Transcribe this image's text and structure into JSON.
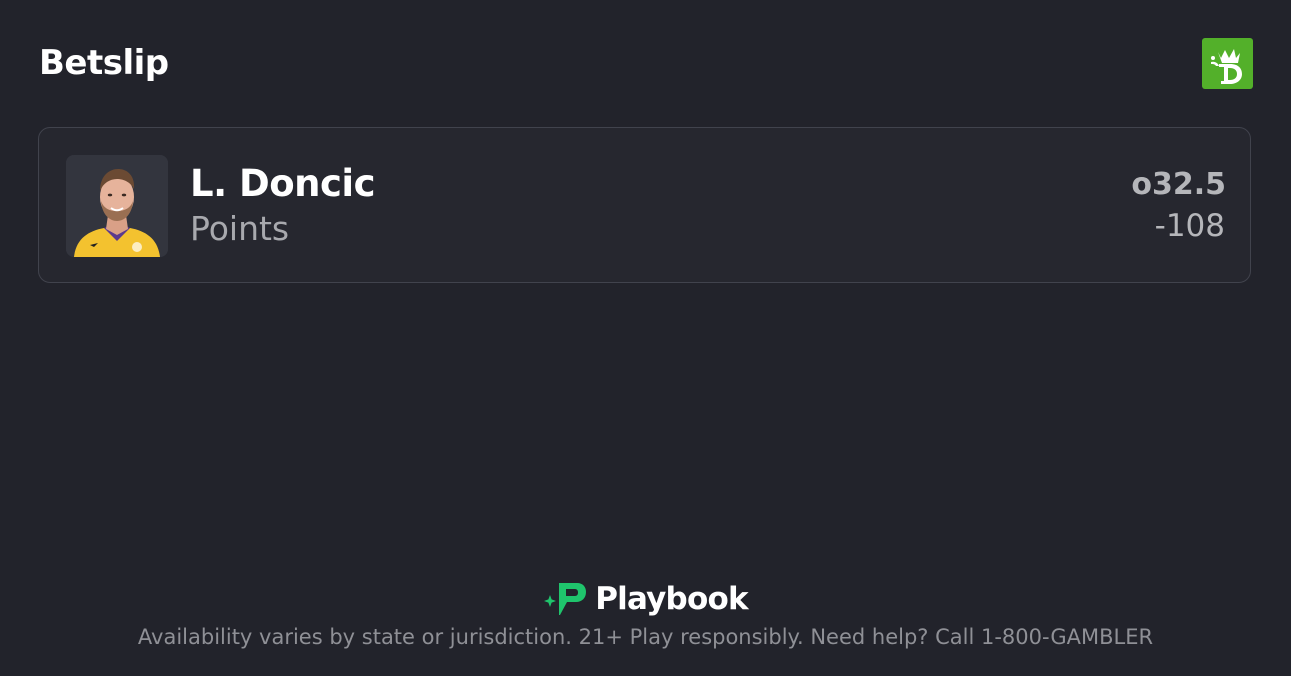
{
  "header": {
    "title": "Betslip",
    "brand_logo": "draftkings-crown-icon",
    "brand_color": "#53b02a"
  },
  "bet": {
    "player_name": "L. Doncic",
    "market": "Points",
    "line": "o32.5",
    "odds": "-108",
    "avatar": "player-headshot"
  },
  "footer": {
    "logo_text": "Playbook",
    "logo_icon": "playbook-p-icon",
    "accent_color": "#1fc46c",
    "disclaimer": "Availability varies by state or jurisdiction. 21+ Play responsibly. Need help? Call 1-800-GAMBLER"
  }
}
